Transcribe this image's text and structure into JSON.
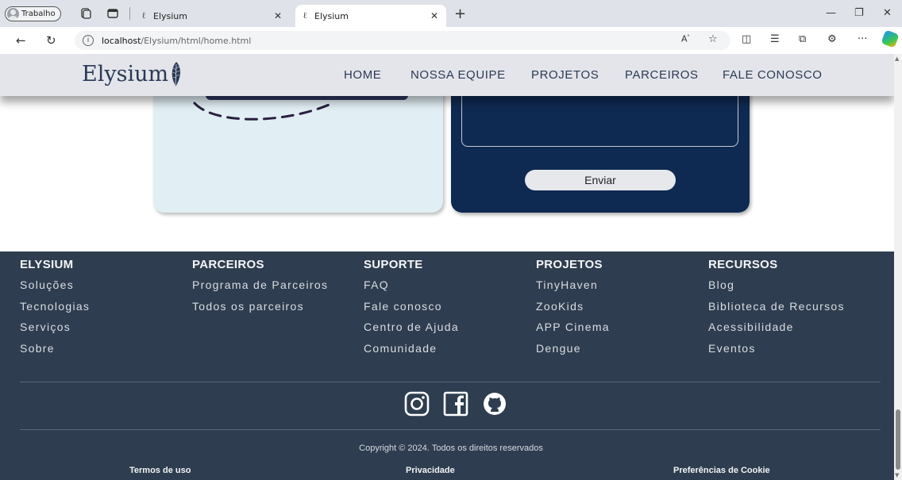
{
  "browser": {
    "profile_label": "Trabalho",
    "tabs": [
      {
        "title": "Elysium",
        "active": false
      },
      {
        "title": "Elysium",
        "active": true
      }
    ],
    "url_host": "localhost",
    "url_path": "/Elysium/html/home.html",
    "icons": [
      "back-icon",
      "refresh-icon",
      "info-icon",
      "read-aloud-icon",
      "favorite-star-icon",
      "split-screen-icon",
      "favorites-icon",
      "collections-icon",
      "extensions-icon",
      "more-icon",
      "copilot-icon"
    ]
  },
  "header": {
    "logo": "Elysium",
    "nav": [
      "HOME",
      "NOSSA EQUIPE",
      "PROJETOS",
      "PARCEIROS",
      "FALE CONOSCO"
    ]
  },
  "contact": {
    "send_label": "Enviar"
  },
  "footer": {
    "columns": [
      {
        "title": "ELYSIUM",
        "links": [
          "Soluções",
          "Tecnologias",
          "Serviços",
          "Sobre"
        ]
      },
      {
        "title": "PARCEIROS",
        "links": [
          "Programa de Parceiros",
          "Todos os parceiros"
        ]
      },
      {
        "title": "SUPORTE",
        "links": [
          "FAQ",
          "Fale conosco",
          "Centro de Ajuda",
          "Comunidade"
        ]
      },
      {
        "title": "PROJETOS",
        "links": [
          "TinyHaven",
          "ZooKids",
          "APP Cinema",
          "Dengue"
        ]
      },
      {
        "title": "RECURSOS",
        "links": [
          "Blog",
          "Biblioteca de Recursos",
          "Acessibilidade",
          "Eventos"
        ]
      }
    ],
    "social": [
      "instagram-icon",
      "facebook-icon",
      "github-icon"
    ],
    "copyright": "Copyright © 2024. Todos os direitos reservados",
    "legal": [
      "Termos de uso",
      "Privacidade",
      "Preferências de Cookie"
    ]
  },
  "colors": {
    "header_bg": "#e3e5ea",
    "footer_bg": "#2e3d4f",
    "card_light": "#e1eef3",
    "card_dark": "#0f2a52"
  }
}
